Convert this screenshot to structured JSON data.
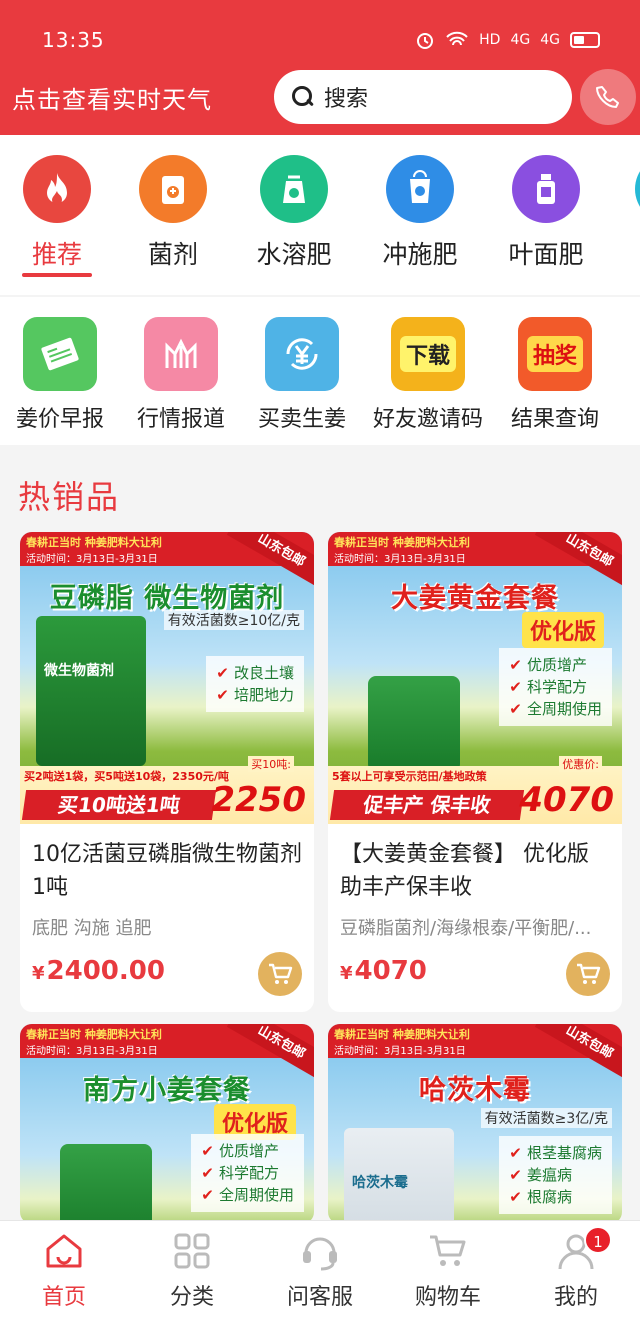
{
  "status_bar": {
    "time": "13:35",
    "hd": "HD",
    "net1": "4G",
    "net2": "4G"
  },
  "header": {
    "weather_link": "点击查看实时天气",
    "search_placeholder": "搜索"
  },
  "categories": [
    {
      "label": "推荐",
      "icon": "fire-icon",
      "color": "#e8473f",
      "active": true
    },
    {
      "label": "菌剂",
      "icon": "fertilizer-bag-icon",
      "color": "#f37b2a"
    },
    {
      "label": "水溶肥",
      "icon": "seedling-bag-icon",
      "color": "#1fbf88"
    },
    {
      "label": "冲施肥",
      "icon": "bucket-icon",
      "color": "#2f8de6"
    },
    {
      "label": "叶面肥",
      "icon": "bottle-icon",
      "color": "#8a4fe0"
    }
  ],
  "tools": [
    {
      "label": "姜价早报",
      "icon": "newspaper-icon",
      "color": "#55c760"
    },
    {
      "label": "行情报道",
      "icon": "market-chart-icon",
      "color": "#f589a5"
    },
    {
      "label": "买卖生姜",
      "icon": "yuan-exchange-icon",
      "color": "#4fb3e6"
    },
    {
      "label": "好友邀请码",
      "icon": "download-badge-icon",
      "color": "#f4b21b",
      "badge_text": "下载"
    },
    {
      "label": "结果查询",
      "icon": "lottery-badge-icon",
      "color": "#f25a2a",
      "badge_text": "抽奖"
    }
  ],
  "section": {
    "title": "热销品"
  },
  "products": [
    {
      "name": "10亿活菌豆磷脂微生物菌剂1吨",
      "tags": "底肥 沟施 追肥",
      "currency": "¥",
      "price": "2400.00",
      "banner": {
        "top_line": "春耕正当时  种姜肥料大让利",
        "date_line": "活动时间：3月13日-3月31日",
        "corner": "山东包邮",
        "headline": "豆磷脂 微生物菌剂",
        "subline": "有效活菌数≥10亿/克",
        "bag_text": "微生物菌剂",
        "bullets": [
          "改良土壤",
          "培肥地力"
        ],
        "strip": "买2吨送1袋，买5吨送10袋，2350元/吨",
        "promo": "买10吨送1吨",
        "price_label": "买10吨:",
        "price": "2250"
      }
    },
    {
      "name": "【大姜黄金套餐】 优化版助丰产保丰收",
      "tags": "豆磷脂菌剂/海缘根泰/平衡肥/...",
      "currency": "¥",
      "price": "4070",
      "banner": {
        "top_line": "春耕正当时  种姜肥料大让利",
        "date_line": "活动时间：3月13日-3月31日",
        "corner": "山东包邮",
        "headline": "大姜黄金套餐",
        "badge": "优化版",
        "bullets": [
          "优质增产",
          "科学配方",
          "全周期使用"
        ],
        "strip": "5套以上可享受示范田/基地政策",
        "promo": "促丰产 保丰收",
        "price_label": "优惠价:",
        "price": "4070"
      }
    },
    {
      "banner": {
        "top_line": "春耕正当时  种姜肥料大让利",
        "date_line": "活动时间：3月13日-3月31日",
        "corner": "山东包邮",
        "headline": "南方小姜套餐",
        "badge": "优化版",
        "bullets": [
          "优质增产",
          "科学配方",
          "全周期使用"
        ]
      }
    },
    {
      "banner": {
        "top_line": "春耕正当时  种姜肥料大让利",
        "date_line": "活动时间：3月13日-3月31日",
        "corner": "山东包邮",
        "headline": "哈茨木霉",
        "subline": "有效活菌数≥3亿/克",
        "bag_text": "哈茨木霉",
        "bullets": [
          "根茎基腐病",
          "姜瘟病",
          "根腐病"
        ]
      }
    }
  ],
  "tabbar": [
    {
      "label": "首页",
      "icon": "home-icon",
      "active": true
    },
    {
      "label": "分类",
      "icon": "grid-icon"
    },
    {
      "label": "问客服",
      "icon": "headset-icon"
    },
    {
      "label": "购物车",
      "icon": "cart-icon"
    },
    {
      "label": "我的",
      "icon": "user-icon",
      "badge": "1"
    }
  ],
  "colors": {
    "brand_red": "#e83a3f",
    "cart_gold": "#e2b25e"
  }
}
